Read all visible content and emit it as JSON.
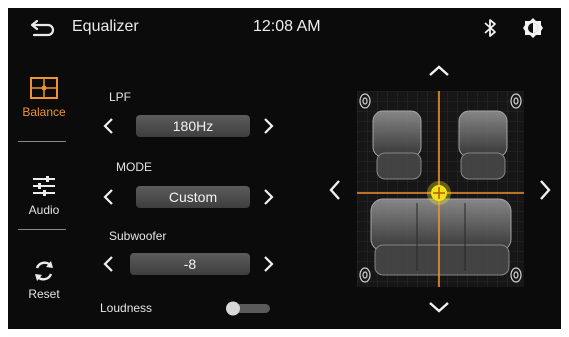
{
  "header": {
    "title": "Equalizer",
    "time": "12:08 AM",
    "back_icon": "back-arrow-icon",
    "bluetooth_icon": "bluetooth-icon",
    "brightness_icon": "brightness-icon"
  },
  "sidebar": {
    "items": [
      {
        "label": "Balance",
        "icon": "balance-crosshair-icon",
        "active": true
      },
      {
        "label": "Audio",
        "icon": "sliders-icon",
        "active": false
      },
      {
        "label": "Reset",
        "icon": "reset-icon",
        "active": false
      }
    ]
  },
  "controls": {
    "lpf": {
      "label": "LPF",
      "value": "180Hz"
    },
    "mode": {
      "label": "MODE",
      "value": "Custom"
    },
    "subwoofer": {
      "label": "Subwoofer",
      "value": "-8"
    },
    "loudness": {
      "label": "Loudness",
      "on": false
    }
  },
  "balance_panel": {
    "icons": [
      "car-seats-icon",
      "speaker-icon",
      "crosshair-handle-icon"
    ],
    "arrows": [
      "arrow-up-icon",
      "arrow-down-icon",
      "arrow-left-icon",
      "arrow-right-icon"
    ]
  },
  "colors": {
    "accent": "#f0922e",
    "background": "#0b0b0b",
    "handle": "#f3e21a"
  }
}
